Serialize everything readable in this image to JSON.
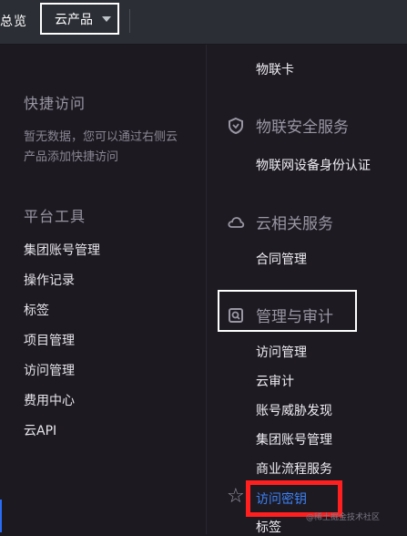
{
  "topbar": {
    "overview": "总览",
    "cloud_products": "云产品"
  },
  "left": {
    "quick_access_title": "快捷访问",
    "quick_access_note": "暂无数据，您可以通过右侧云产品添加快捷访问",
    "platform_tools_title": "平台工具",
    "items": [
      "集团账号管理",
      "操作记录",
      "标签",
      "项目管理",
      "访问管理",
      "费用中心",
      "云API"
    ]
  },
  "right": {
    "iot_card": "物联卡",
    "iot_security": {
      "title": "物联安全服务",
      "items": [
        "物联网设备身份认证"
      ]
    },
    "cloud_related": {
      "title": "云相关服务",
      "items": [
        "合同管理"
      ]
    },
    "mgmt_audit": {
      "title": "管理与审计",
      "items": [
        "访问管理",
        "云审计",
        "账号威胁发现",
        "集团账号管理",
        "商业流程服务",
        "访问密钥",
        "标签"
      ]
    }
  },
  "watermark": "@稀土掘金技术社区",
  "colors": {
    "highlight": "#ff1f1f",
    "link_active": "#3b82f6"
  }
}
